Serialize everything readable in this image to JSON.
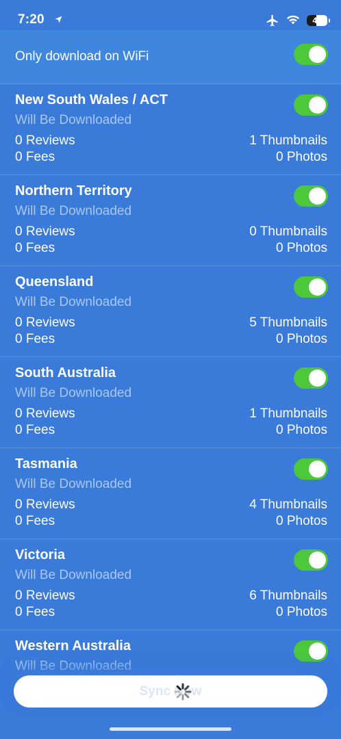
{
  "status_bar": {
    "time": "7:20",
    "battery": "47",
    "battery_level": 0.47,
    "icons": [
      "location-arrow-icon",
      "airplane-icon",
      "wifi-icon",
      "battery-icon"
    ]
  },
  "wifi_setting": {
    "label": "Only download on WiFi",
    "enabled": true
  },
  "regions": [
    {
      "name": "New South Wales / ACT",
      "status": "Will Be Downloaded",
      "reviews": "0 Reviews",
      "fees": "0 Fees",
      "thumbnails": "1 Thumbnails",
      "photos": "0 Photos",
      "enabled": true
    },
    {
      "name": "Northern Territory",
      "status": "Will Be Downloaded",
      "reviews": "0 Reviews",
      "fees": "0 Fees",
      "thumbnails": "0 Thumbnails",
      "photos": "0 Photos",
      "enabled": true
    },
    {
      "name": "Queensland",
      "status": "Will Be Downloaded",
      "reviews": "0 Reviews",
      "fees": "0 Fees",
      "thumbnails": "5 Thumbnails",
      "photos": "0 Photos",
      "enabled": true
    },
    {
      "name": "South Australia",
      "status": "Will Be Downloaded",
      "reviews": "0 Reviews",
      "fees": "0 Fees",
      "thumbnails": "1 Thumbnails",
      "photos": "0 Photos",
      "enabled": true
    },
    {
      "name": "Tasmania",
      "status": "Will Be Downloaded",
      "reviews": "0 Reviews",
      "fees": "0 Fees",
      "thumbnails": "4 Thumbnails",
      "photos": "0 Photos",
      "enabled": true
    },
    {
      "name": "Victoria",
      "status": "Will Be Downloaded",
      "reviews": "0 Reviews",
      "fees": "0 Fees",
      "thumbnails": "6 Thumbnails",
      "photos": "0 Photos",
      "enabled": true
    },
    {
      "name": "Western Australia",
      "status": "Will Be Downloaded",
      "reviews": "",
      "fees": "",
      "thumbnails": "",
      "photos": "",
      "enabled": true
    }
  ],
  "sync_button": {
    "label": "Sync Now",
    "loading": true
  },
  "colors": {
    "background": "#3a7ad9",
    "toggle_on": "#4cc83a",
    "status_text": "#a9c8f2"
  }
}
